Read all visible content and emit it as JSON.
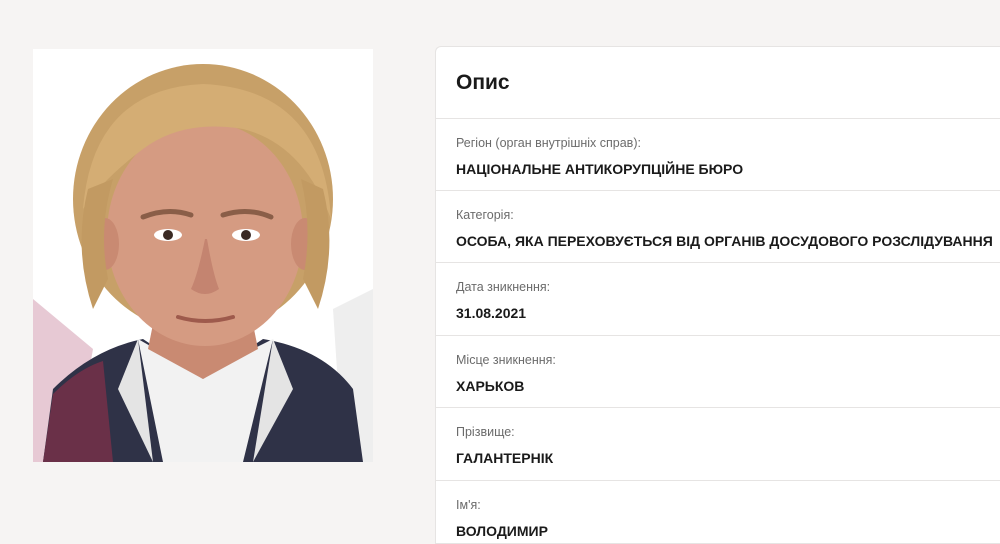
{
  "card": {
    "title": "Опис"
  },
  "fields": [
    {
      "label": "Регіон (орган внутрішніх справ):",
      "value": "НАЦІОНАЛЬНЕ АНТИКОРУПЦІЙНЕ БЮРО"
    },
    {
      "label": "Категорія:",
      "value": "ОСОБА, ЯКА ПЕРЕХОВУЄТЬСЯ ВІД ОРГАНІВ ДОСУДОВОГО РОЗСЛІДУВАННЯ"
    },
    {
      "label": "Дата зникнення:",
      "value": "31.08.2021"
    },
    {
      "label": "Місце зникнення:",
      "value": "ХАРЬКОВ"
    },
    {
      "label": "Прізвище:",
      "value": "ГАЛАНТЕРНІК"
    },
    {
      "label": "Ім'я:",
      "value": "ВОЛОДИМИР"
    }
  ],
  "colors": {
    "page_background": "#f6f4f3",
    "card_background": "#ffffff",
    "divider": "#e6e4e3",
    "label_text": "#6b6b6b",
    "value_text": "#1a1a1a"
  }
}
